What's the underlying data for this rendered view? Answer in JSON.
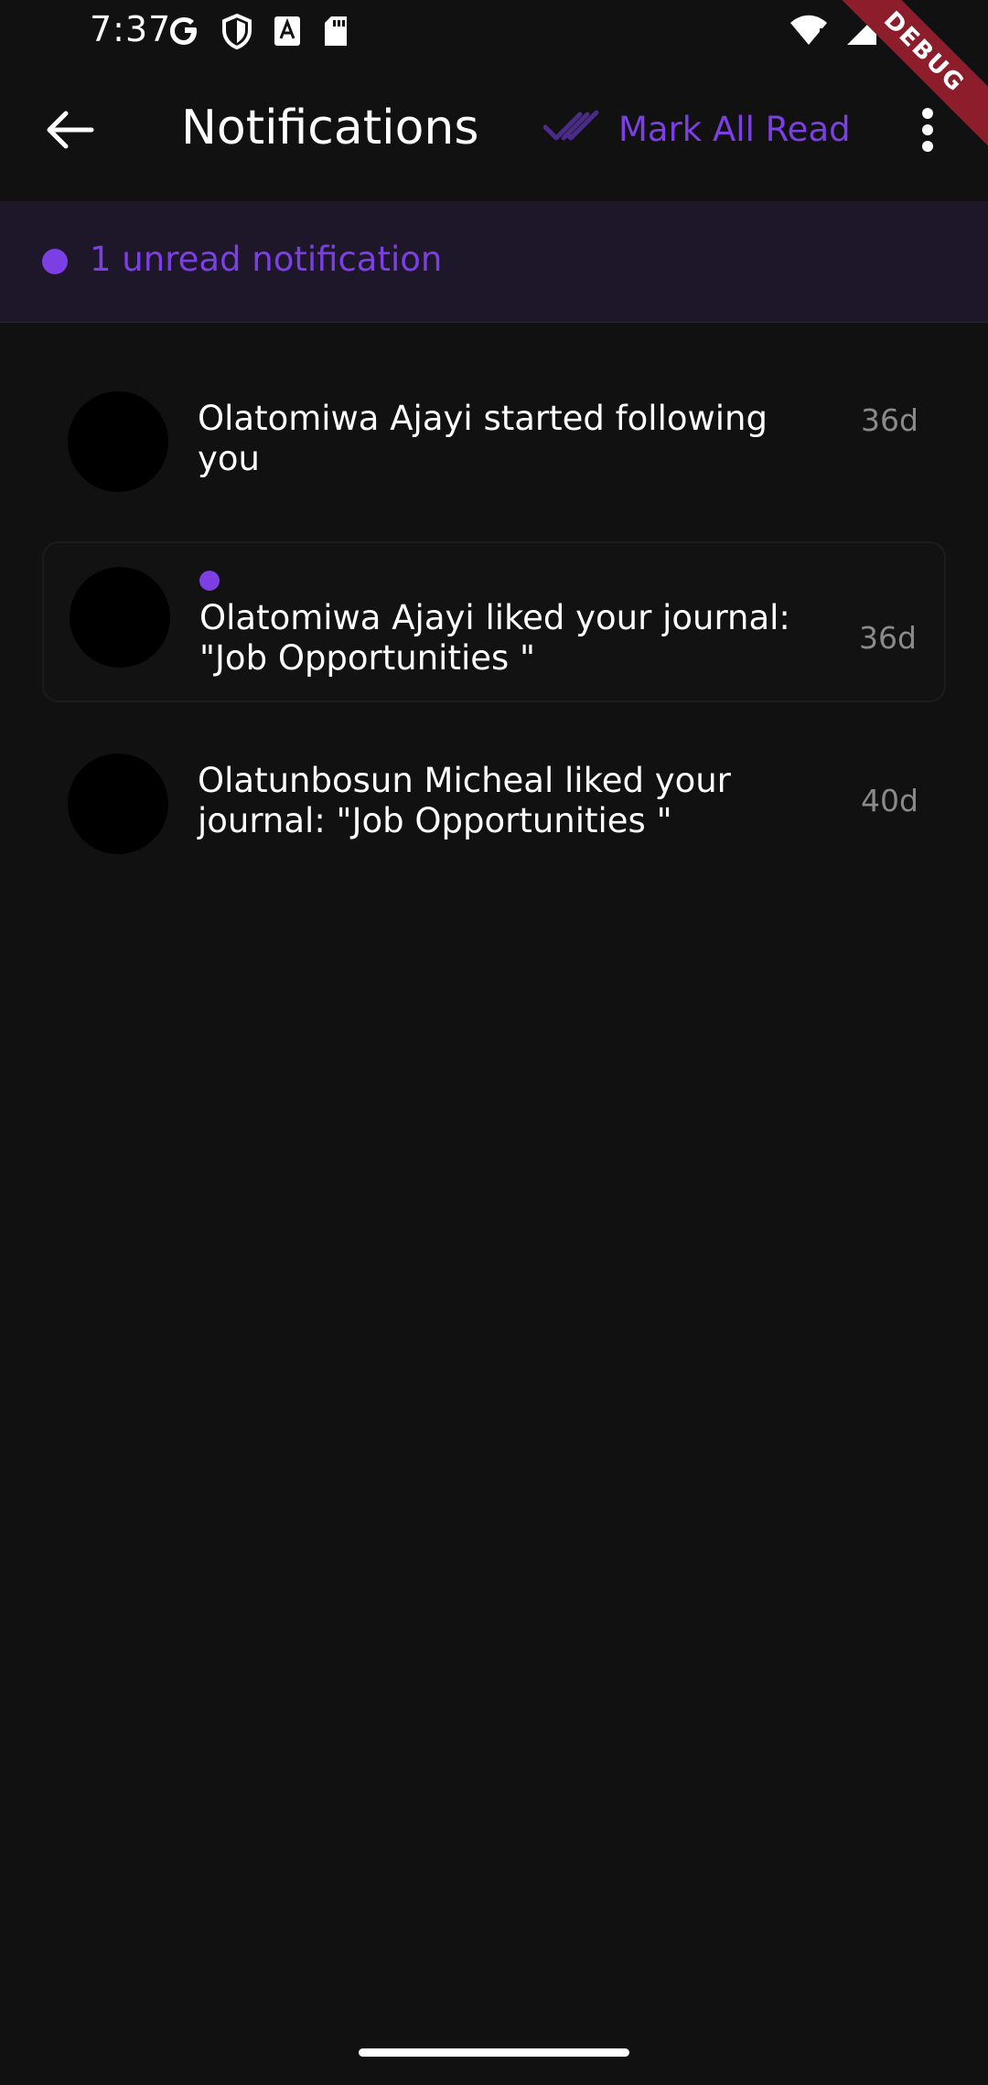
{
  "status_bar": {
    "time": "7:37",
    "left_icons": [
      "google-icon",
      "shield-icon",
      "font-icon",
      "sd-card-icon"
    ],
    "right_icons": [
      "wifi-icon",
      "signal-icon",
      "battery-icon"
    ],
    "debug_banner": "DEBUG"
  },
  "app_bar": {
    "title": "Notifications",
    "mark_all_read_label": "Mark All Read"
  },
  "unread_banner": {
    "text": "1 unread notification"
  },
  "notifications": [
    {
      "text": "Olatomiwa Ajayi started following you",
      "time": "36d",
      "unread": false
    },
    {
      "text": "Olatomiwa Ajayi liked your journal: \"Job Opportunities \"",
      "time": "36d",
      "unread": true
    },
    {
      "text": "Olatunbosun Micheal liked your journal: \"Job Opportunities \"",
      "time": "40d",
      "unread": false
    }
  ],
  "colors": {
    "background": "#111111",
    "accent": "#7b3fe4",
    "banner_bg": "#1d1729",
    "muted_text": "#8a8a8a",
    "debug_red": "#8d1d2b"
  }
}
